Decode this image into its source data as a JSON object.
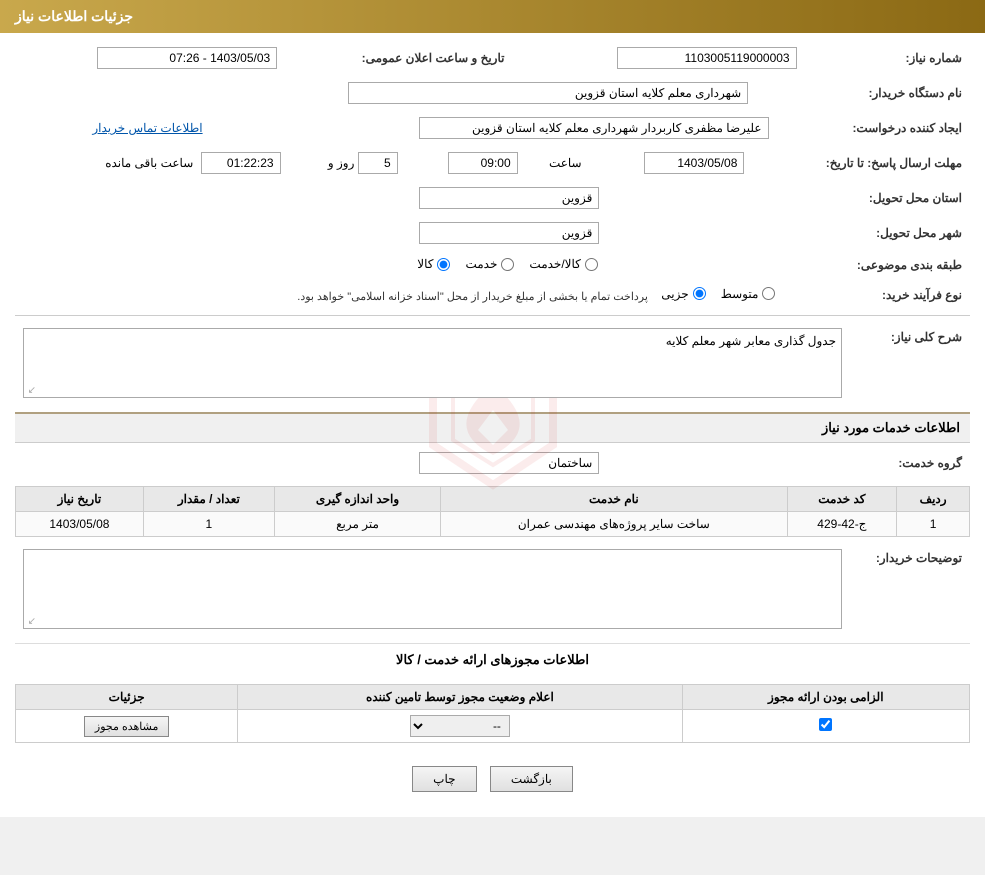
{
  "page": {
    "title": "جزئیات اطلاعات نیاز"
  },
  "header": {
    "title": "جزئیات اطلاعات نیاز"
  },
  "form": {
    "need_number_label": "شماره نیاز:",
    "need_number_value": "1103005119000003",
    "date_label": "تاریخ و ساعت اعلان عمومی:",
    "date_value": "1403/05/03 - 07:26",
    "buyer_org_label": "نام دستگاه خریدار:",
    "buyer_org_value": "شهرداری معلم کلایه استان قزوین",
    "creator_label": "ایجاد کننده درخواست:",
    "creator_value": "علیرضا مظفری کاربردار شهرداری معلم کلایه استان قزوین",
    "contact_link": "اطلاعات تماس خریدار",
    "deadline_label": "مهلت ارسال پاسخ: تا تاریخ:",
    "deadline_date": "1403/05/08",
    "deadline_time_label": "ساعت",
    "deadline_time": "09:00",
    "deadline_days_label": "روز و",
    "deadline_days": "5",
    "deadline_remaining_label": "ساعت باقی مانده",
    "deadline_remaining": "01:22:23",
    "province_label": "استان محل تحویل:",
    "province_value": "قزوین",
    "city_label": "شهر محل تحویل:",
    "city_value": "قزوین",
    "category_label": "طبقه بندی موضوعی:",
    "category_options": [
      "کالا",
      "خدمت",
      "کالا/خدمت"
    ],
    "category_selected": "کالا",
    "purchase_type_label": "نوع فرآیند خرید:",
    "purchase_types": [
      "جزیی",
      "متوسط"
    ],
    "purchase_note": "پرداخت تمام یا بخشی از مبلغ خریدار از محل \"اسناد خزانه اسلامی\" خواهد بود.",
    "description_label": "شرح کلی نیاز:",
    "description_value": "جدول گذاری معابر شهر معلم کلایه",
    "services_section_title": "اطلاعات خدمات مورد نیاز",
    "service_group_label": "گروه خدمت:",
    "service_group_value": "ساختمان"
  },
  "services_table": {
    "columns": [
      "ردیف",
      "کد خدمت",
      "نام خدمت",
      "واحد اندازه گیری",
      "تعداد / مقدار",
      "تاریخ نیاز"
    ],
    "rows": [
      {
        "row": "1",
        "code": "ج-42-429",
        "name": "ساخت سایر پروژه‌های مهندسی عمران",
        "unit": "متر مربع",
        "quantity": "1",
        "date": "1403/05/08"
      }
    ]
  },
  "buyer_desc_label": "توضیحات خریدار:",
  "permissions_section_title": "اطلاعات مجوزهای ارائه خدمت / کالا",
  "permissions_table": {
    "columns": [
      "الزامی بودن ارائه مجوز",
      "اعلام وضعیت مجوز توسط تامین کننده",
      "جزئیات"
    ],
    "rows": [
      {
        "required": true,
        "status_options": [
          "--"
        ],
        "status_selected": "--",
        "details_btn": "مشاهده مجوز"
      }
    ]
  },
  "buttons": {
    "print": "چاپ",
    "back": "بازگشت"
  }
}
